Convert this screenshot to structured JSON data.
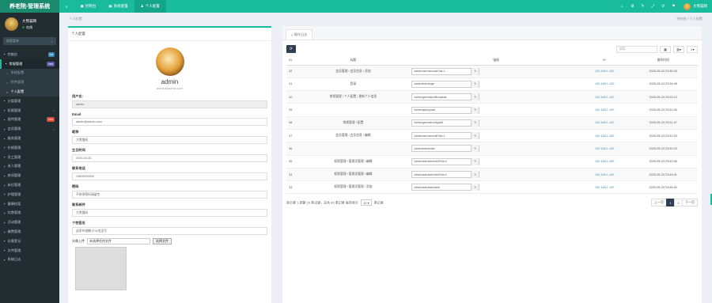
{
  "brand": "养老院-管理系统",
  "topnav": {
    "items": [
      {
        "icon": "≡",
        "label": ""
      },
      {
        "icon": "▣",
        "label": "控制台"
      },
      {
        "icon": "▣",
        "label": "系统配置"
      },
      {
        "icon": "♟",
        "label": "个人配置"
      }
    ],
    "right_icons": [
      "⌂",
      "⚙",
      "✎",
      "⤢",
      "⟳",
      "⚑"
    ],
    "user": "大熊猫网"
  },
  "sidebar": {
    "user": {
      "name": "大熊猫网",
      "status": "在线"
    },
    "search_placeholder": "搜索菜单",
    "items": [
      {
        "label": "控制台",
        "badge": "hot",
        "badge_color": "#3c8dbc"
      },
      {
        "label": "常规管理",
        "badge": "new",
        "badge_color": "#605ca8",
        "active": true
      },
      {
        "label": "系统配置",
        "sub": true
      },
      {
        "label": "附件管理",
        "sub": true
      },
      {
        "label": "个人配置",
        "sub": true,
        "current": true
      },
      {
        "label": "分类管理"
      },
      {
        "label": "权限管理",
        "arrow": "‹"
      },
      {
        "label": "插件管理",
        "badge": "new",
        "badge_color": "#dd4b39"
      },
      {
        "label": "会员管理",
        "arrow": "‹"
      },
      {
        "label": "服务管理"
      },
      {
        "label": "价格管理"
      },
      {
        "label": "员工管理"
      },
      {
        "label": "老人管理"
      },
      {
        "label": "房间管理"
      },
      {
        "label": "床位管理"
      },
      {
        "label": "护理管理"
      },
      {
        "label": "健康档案"
      },
      {
        "label": "饮食管理"
      },
      {
        "label": "活动管理"
      },
      {
        "label": "缴费管理"
      },
      {
        "label": "访客登记"
      },
      {
        "label": "文件管理"
      },
      {
        "label": "系统日志"
      }
    ]
  },
  "breadcrumb": {
    "left": "个人配置",
    "right": "控制台 / 个人配置"
  },
  "profile": {
    "header": "个人配置",
    "name": "admin",
    "email": "admin@admin.com",
    "fields": [
      {
        "label": "用户名:",
        "value": "admin",
        "readonly": true
      },
      {
        "label": "Email",
        "value": "admin@admin.com"
      },
      {
        "label": "昵称",
        "value": "大熊猫网"
      },
      {
        "label": "生日时间",
        "value": "2020-03-25"
      },
      {
        "label": "联系电话",
        "value": "13800000000"
      },
      {
        "label": "密码",
        "value": "不修改密码请留空"
      },
      {
        "label": "联系邮件",
        "value": "大熊猫网"
      },
      {
        "label": "个性签名",
        "value": "这家伙很懒,什么也没写"
      }
    ],
    "avatar_label": "头像上传",
    "upload_text": "未选择任何文件",
    "upload_button": "选择文件"
  },
  "logs": {
    "tab": "操作日志",
    "search_placeholder": "搜索",
    "columns": [
      "ID",
      "标题",
      "链接",
      "IP",
      "操作时间"
    ],
    "rows": [
      {
        "id": "42",
        "title": "会员管理 / 会员信息 / 添加",
        "url": "/admin/user/user/add?ids=1",
        "ip": "192.168.1.100",
        "time": "2020-05-23 23:56:33"
      },
      {
        "id": "41",
        "title": "登录",
        "url": "/admin/index/login",
        "ip": "192.168.1.100",
        "time": "2020-05-23 23:54:48"
      },
      {
        "id": "40",
        "title": "常规管理 / 个人配置 / 更新个人信息",
        "url": "/admin/general/profile/update",
        "ip": "192.168.1.100",
        "time": "2020-05-23 23:52:13"
      },
      {
        "id": "39",
        "title": "",
        "url": "/admin/ajax/upload",
        "ip": "192.168.1.100",
        "time": "2020-05-23 23:52:06"
      },
      {
        "id": "38",
        "title": "常规管理 / 配置",
        "url": "/admin/general/config/edit",
        "ip": "192.168.1.100",
        "time": "2020-05-23 23:51:47"
      },
      {
        "id": "37",
        "title": "会员管理 / 会员信息 / 编辑",
        "url": "/admin/user/user/edit?ids=1",
        "ip": "192.168.1.100",
        "time": "2020-05-23 23:51:03"
      },
      {
        "id": "36",
        "title": "",
        "url": "/admin/index/index",
        "ip": "192.168.1.100",
        "time": "2020-05-23 23:50:23"
      },
      {
        "id": "35",
        "title": "权限管理 / 管理员管理 / 编辑",
        "url": "/admin/auth/admin/edit?ids=2",
        "ip": "192.168.1.100",
        "time": "2020-05-23 23:49:58"
      },
      {
        "id": "34",
        "title": "权限管理 / 管理员管理 / 编辑",
        "url": "/admin/auth/admin/edit?ids=2",
        "ip": "192.168.1.100",
        "time": "2020-05-23 23:49:41"
      },
      {
        "id": "33",
        "title": "权限管理 / 管理员管理 / 添加",
        "url": "/admin/auth/admin/add",
        "ip": "192.168.1.100",
        "time": "2020-05-23 23:48:30"
      }
    ],
    "footer": {
      "summary": "显示第 1 到第 10 条记录，总共 42 条记录 每页显示",
      "per_page": "10",
      "suffix": "条记录"
    },
    "pager": [
      "上一页",
      "1",
      "2",
      "下一页"
    ]
  }
}
